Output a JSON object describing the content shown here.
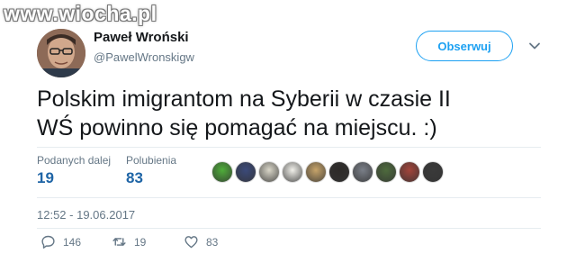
{
  "watermark": "www.wiocha.pl",
  "author": {
    "name": "Paweł Wroński",
    "handle": "@PawelWronskigw"
  },
  "follow_label": "Obserwuj",
  "tweet_text_line1": "Polskim imigrantom na Syberii w czasie II",
  "tweet_text_line2": "WŚ powinno się pomagać na miejscu. :)",
  "stats": {
    "retweets_label": "Podanych dalej",
    "retweets_value": "19",
    "likes_label": "Polubienia",
    "likes_value": "83"
  },
  "liker_avatar_colors": [
    "#4fae3a",
    "#3b4a7a",
    "#d9d6c8",
    "#f1f0ea",
    "#c7a46a",
    "#2d2a28",
    "#7a7f88",
    "#4e6b3d",
    "#a3443a",
    "#3a3a3a"
  ],
  "timestamp": "12:52 - 19.06.2017",
  "actions": {
    "reply_count": "146",
    "retweet_count": "19",
    "like_count": "83"
  },
  "colors": {
    "accent": "#1da1f2",
    "stat_value": "#1f65a6",
    "secondary_text": "#657786"
  }
}
